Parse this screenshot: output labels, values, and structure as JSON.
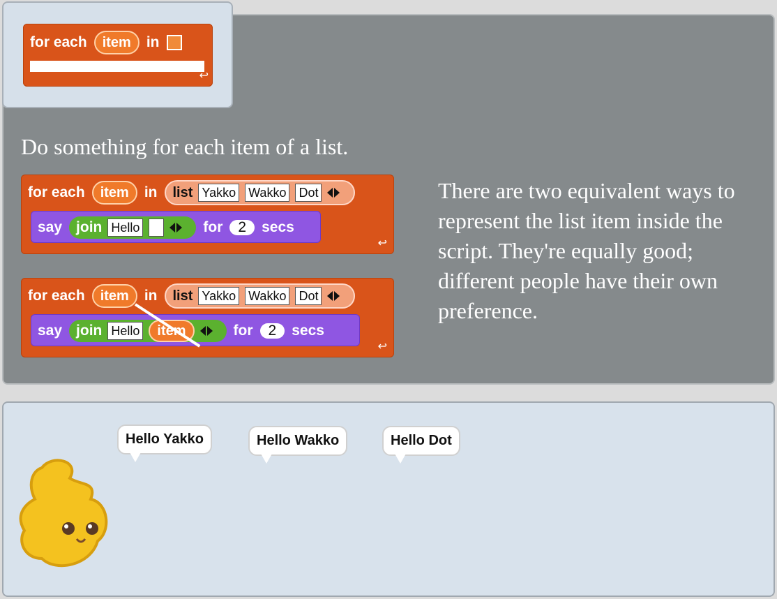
{
  "badge": {
    "for_each": "for each",
    "item": "item",
    "in": "in"
  },
  "description": "Do something for each item of a list.",
  "side_text": "There are two equivalent ways to represent the list item inside the script. They're equally good; different people have their own preference.",
  "script1": {
    "for_each": "for each",
    "item": "item",
    "in": "in",
    "list": "list",
    "items": [
      "Yakko",
      "Wakko",
      "Dot"
    ],
    "say": "say",
    "join": "join",
    "hello": "Hello",
    "for": "for",
    "secs_value": "2",
    "secs": "secs"
  },
  "script2": {
    "for_each": "for each",
    "item": "item",
    "in": "in",
    "list": "list",
    "items": [
      "Yakko",
      "Wakko",
      "Dot"
    ],
    "say": "say",
    "join": "join",
    "hello": "Hello",
    "join_item": "item",
    "for": "for",
    "secs_value": "2",
    "secs": "secs"
  },
  "stage": {
    "bubbles": [
      "Hello Yakko",
      "Hello Wakko",
      "Hello Dot"
    ]
  },
  "colors": {
    "control_block": "#d9541a",
    "looks_block": "#8f56e2",
    "operators_block": "#5bb12f"
  }
}
